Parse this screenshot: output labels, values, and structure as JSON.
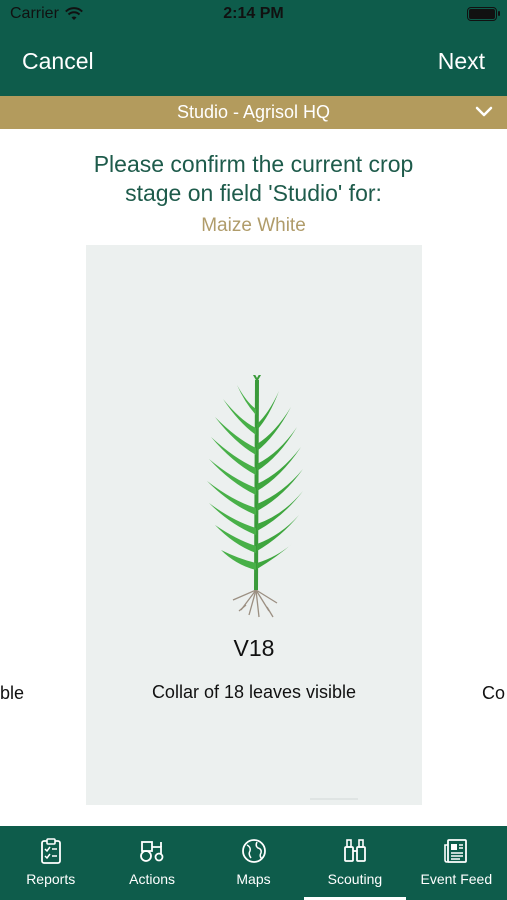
{
  "status_bar": {
    "carrier": "Carrier",
    "time": "2:14 PM"
  },
  "nav": {
    "cancel_label": "Cancel",
    "next_label": "Next"
  },
  "field_selector": {
    "label": "Studio - Agrisol HQ"
  },
  "prompt": {
    "line1": "Please confirm the current crop",
    "line2": "stage on field 'Studio' for:",
    "crop": "Maize White"
  },
  "stage_card": {
    "code": "V18",
    "description": "Collar of 18 leaves visible",
    "prev_fragment": "ble",
    "next_fragment": "Co"
  },
  "tabs": [
    {
      "label": "Reports",
      "icon": "clipboard-icon"
    },
    {
      "label": "Actions",
      "icon": "tractor-icon"
    },
    {
      "label": "Maps",
      "icon": "globe-icon"
    },
    {
      "label": "Scouting",
      "icon": "binoculars-icon",
      "selected": true
    },
    {
      "label": "Event Feed",
      "icon": "newspaper-icon"
    }
  ],
  "colors": {
    "primary": "#0e5c4b",
    "gold": "#b39b5d",
    "card": "#ecf0ef"
  }
}
